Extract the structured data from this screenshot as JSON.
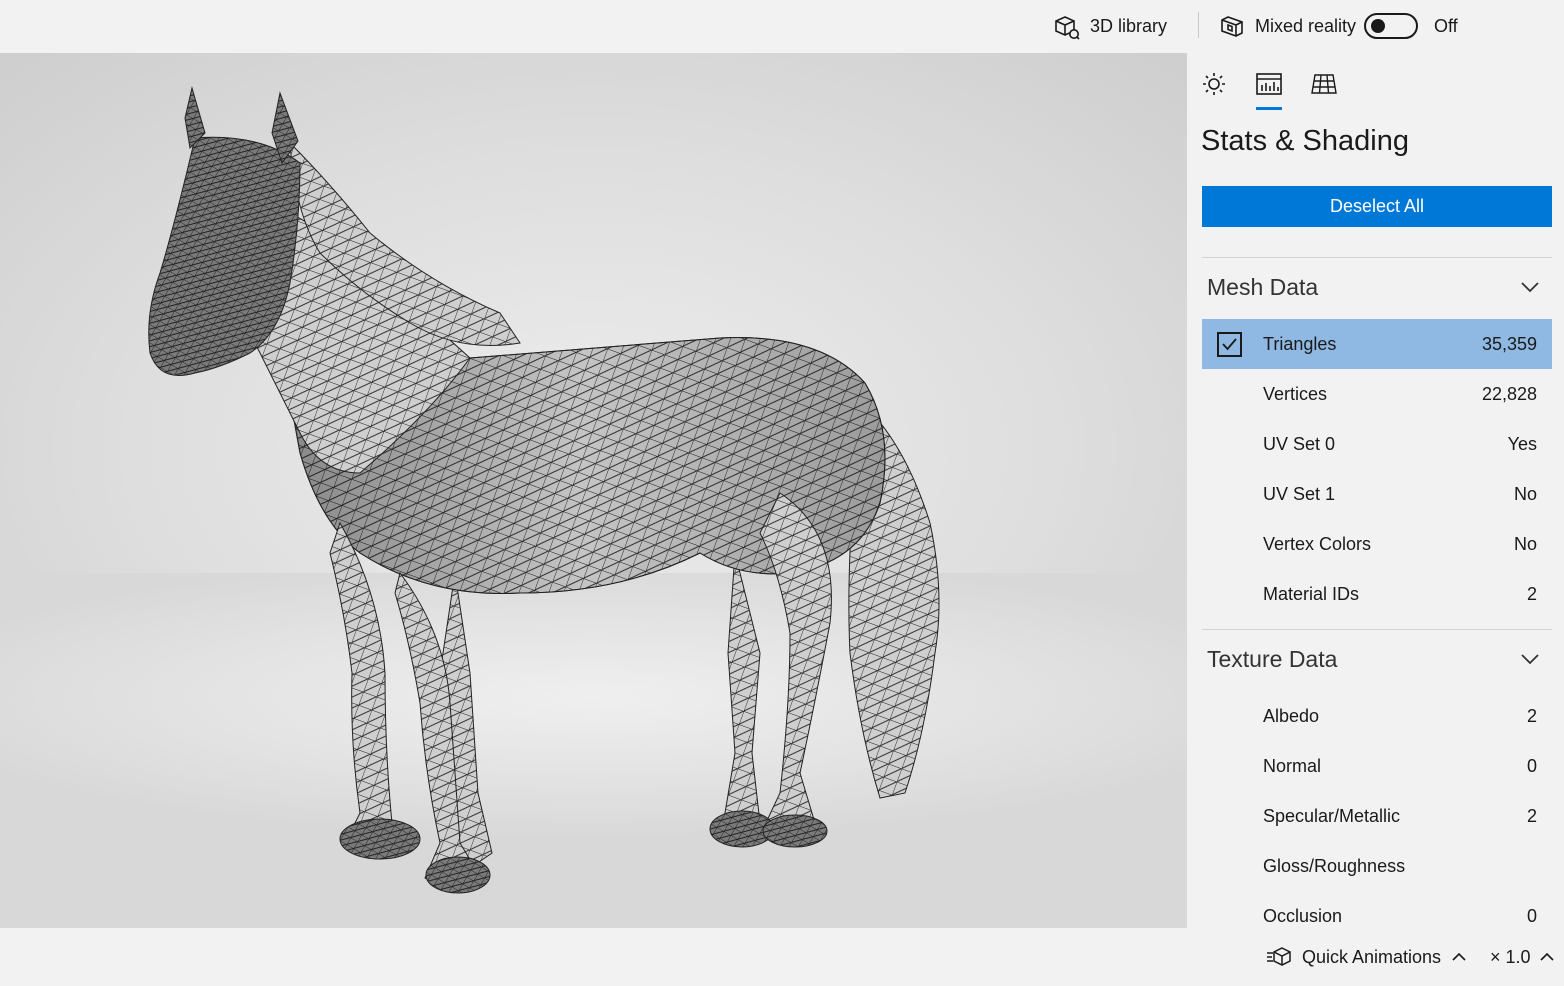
{
  "topbar": {
    "library_label": "3D library",
    "mixed_reality_label": "Mixed reality",
    "toggle_state": "Off"
  },
  "panel": {
    "tabs": [
      {
        "name": "lighting",
        "icon": "sun-icon"
      },
      {
        "name": "stats",
        "icon": "stats-chart-icon",
        "active": true
      },
      {
        "name": "grid",
        "icon": "grid-icon"
      }
    ],
    "title": "Stats & Shading",
    "deselect_label": "Deselect All",
    "mesh": {
      "title": "Mesh Data",
      "rows": [
        {
          "label": "Triangles",
          "value": "35,359",
          "selected": true
        },
        {
          "label": "Vertices",
          "value": "22,828"
        },
        {
          "label": "UV Set 0",
          "value": "Yes"
        },
        {
          "label": "UV Set 1",
          "value": "No"
        },
        {
          "label": "Vertex Colors",
          "value": "No"
        },
        {
          "label": "Material IDs",
          "value": "2"
        }
      ]
    },
    "texture": {
      "title": "Texture Data",
      "rows": [
        {
          "label": "Albedo",
          "value": "2"
        },
        {
          "label": "Normal",
          "value": "0"
        },
        {
          "label": "Specular/Metallic",
          "value": "2"
        },
        {
          "label": "Gloss/Roughness",
          "value": ""
        },
        {
          "label": "Occlusion",
          "value": "0"
        }
      ]
    },
    "accent_color": "#0078d7",
    "selected_row_color": "#8fb8e3"
  },
  "bottombar": {
    "animations_label": "Quick Animations",
    "speed_label": "× 1.0"
  }
}
